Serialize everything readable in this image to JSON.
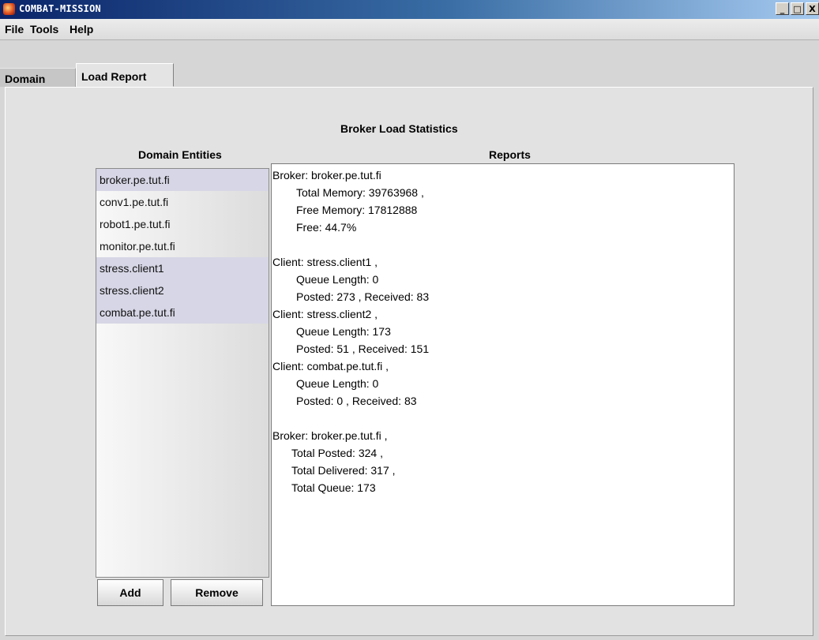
{
  "window": {
    "title": "COMBAT-MISSION",
    "buttons": {
      "minimize": "_",
      "maximize": "□",
      "close": "X"
    }
  },
  "menu": {
    "items": [
      {
        "label": "File"
      },
      {
        "label": "Tools"
      },
      {
        "label": "Help"
      }
    ]
  },
  "tabs": [
    {
      "label": "Domain",
      "active": false
    },
    {
      "label": "Load Report",
      "active": true
    }
  ],
  "panel": {
    "title": "Broker Load Statistics",
    "entities_heading": "Domain Entities",
    "reports_heading": "Reports"
  },
  "entities": [
    {
      "name": "broker.pe.tut.fi",
      "selected": true
    },
    {
      "name": "conv1.pe.tut.fi",
      "selected": false
    },
    {
      "name": "robot1.pe.tut.fi",
      "selected": false
    },
    {
      "name": "monitor.pe.tut.fi",
      "selected": false
    },
    {
      "name": "stress.client1",
      "selected": true
    },
    {
      "name": "stress.client2",
      "selected": true
    },
    {
      "name": "combat.pe.tut.fi",
      "selected": true
    }
  ],
  "buttons": {
    "add": "Add",
    "remove": "Remove"
  },
  "report_lines": [
    "Broker: broker.pe.tut.fi",
    "Total Memory: 39763968 ,",
    "Free Memory: 17812888",
    "Free: 44.7%",
    "",
    "Client: stress.client1 ,",
    "Queue Length: 0",
    "Posted: 273 , Received: 83",
    "Client: stress.client2 ,",
    "Queue Length: 173",
    "Posted: 51 , Received: 151",
    "Client: combat.pe.tut.fi ,",
    "Queue Length: 0",
    "Posted: 0 , Received: 83",
    "",
    "Broker: broker.pe.tut.fi ,",
    "Total Posted: 324 ,",
    "Total Delivered: 317 ,",
    "Total Queue: 173"
  ]
}
